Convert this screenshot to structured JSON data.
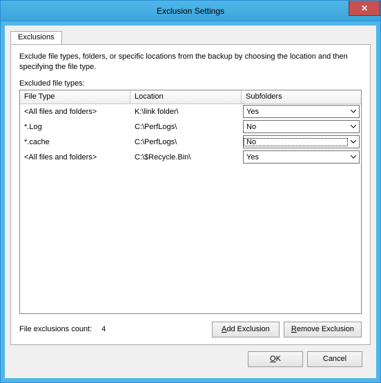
{
  "window": {
    "title": "Exclusion Settings",
    "close_tooltip": "Close"
  },
  "tabs": {
    "exclusions_label": "Exclusions"
  },
  "panel": {
    "description": "Exclude file types, folders, or specific locations from the backup by choosing the location and then specifying the file type.",
    "list_label": "Excluded file types:",
    "headers": {
      "file_type": "File Type",
      "location": "Location",
      "subfolders": "Subfolders"
    },
    "rows": [
      {
        "file_type": "<All files and folders>",
        "location": "K:\\link folder\\",
        "subfolders": "Yes",
        "focused": false
      },
      {
        "file_type": "*.Log",
        "location": "C:\\PerfLogs\\",
        "subfolders": "No",
        "focused": false
      },
      {
        "file_type": "*.cache",
        "location": "C:\\PerfLogs\\",
        "subfolders": "No",
        "focused": true
      },
      {
        "file_type": "<All files and folders>",
        "location": "C:\\$Recycle.Bin\\",
        "subfolders": "Yes",
        "focused": false
      }
    ],
    "count_label": "File exclusions count:",
    "count_value": "4",
    "add_label_pre": "",
    "add_label_u": "A",
    "add_label_post": "dd Exclusion",
    "remove_label_pre": "",
    "remove_label_u": "R",
    "remove_label_post": "emove Exclusion"
  },
  "footer": {
    "ok_pre": "",
    "ok_u": "O",
    "ok_post": "K",
    "cancel": "Cancel"
  }
}
